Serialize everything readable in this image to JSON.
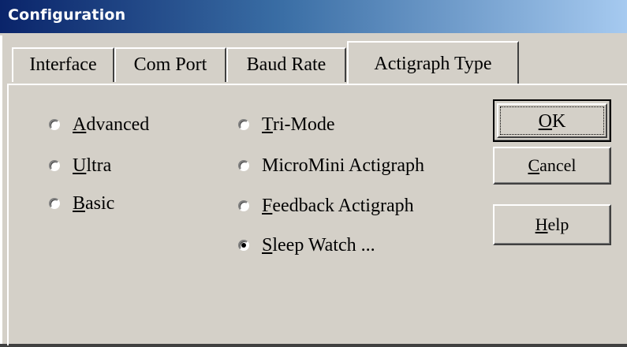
{
  "window": {
    "title": "Configuration"
  },
  "tabs": [
    {
      "label": "Interface",
      "active": false
    },
    {
      "label": "Com Port",
      "active": false
    },
    {
      "label": "Baud Rate",
      "active": false
    },
    {
      "label": "Actigraph Type",
      "active": true
    }
  ],
  "radios": {
    "advanced": {
      "access": "A",
      "rest": "dvanced",
      "checked": false
    },
    "ultra": {
      "access": "U",
      "rest": "ltra",
      "checked": false
    },
    "basic": {
      "access": "B",
      "rest": "asic",
      "checked": false
    },
    "trimode": {
      "access": "T",
      "rest": "ri-Mode",
      "checked": false
    },
    "micromini": {
      "access": "",
      "rest": "MicroMini Actigraph",
      "checked": false
    },
    "feedback": {
      "access": "F",
      "rest": "eedback Actigraph",
      "checked": false
    },
    "sleepwatch": {
      "access": "S",
      "rest": "leep Watch ...",
      "checked": true
    }
  },
  "buttons": {
    "ok": {
      "access": "O",
      "rest": "K"
    },
    "cancel": {
      "access": "C",
      "rest": "ancel"
    },
    "help": {
      "access": "H",
      "rest": "elp"
    }
  },
  "colors": {
    "face": "#d4d0c8",
    "title_start": "#0a246a",
    "title_end": "#a6caf0"
  }
}
